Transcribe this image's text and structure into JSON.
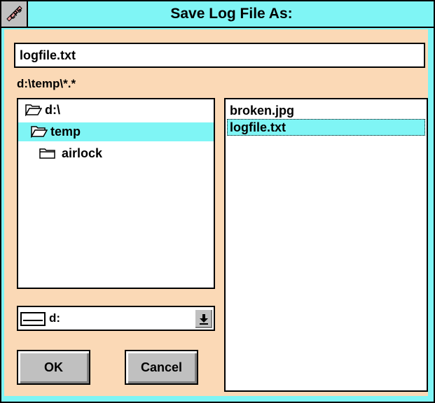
{
  "dialog": {
    "title": "Save Log File As:",
    "icon": "cps-logo-icon"
  },
  "filename": {
    "value": "logfile.txt"
  },
  "current_path": "d:\\temp\\*.*",
  "directories": [
    {
      "label": "d:\\",
      "icon": "open-folder-icon",
      "selected": false
    },
    {
      "label": "temp",
      "icon": "open-folder-icon",
      "selected": true
    },
    {
      "label": "airlock",
      "icon": "closed-folder-icon",
      "selected": false
    }
  ],
  "files": [
    {
      "label": "broken.jpg",
      "selected": false
    },
    {
      "label": "logfile.txt",
      "selected": true
    }
  ],
  "drive": {
    "value": "d:",
    "icon": "drive-icon",
    "arrow_icon": "down-arrow-icon"
  },
  "buttons": {
    "ok": "OK",
    "cancel": "Cancel"
  },
  "colors": {
    "title_bg": "#7ff5f5",
    "client_bg": "#fbd9b6",
    "selection": "#7ff5f5",
    "button_face": "#c0c0c0"
  }
}
